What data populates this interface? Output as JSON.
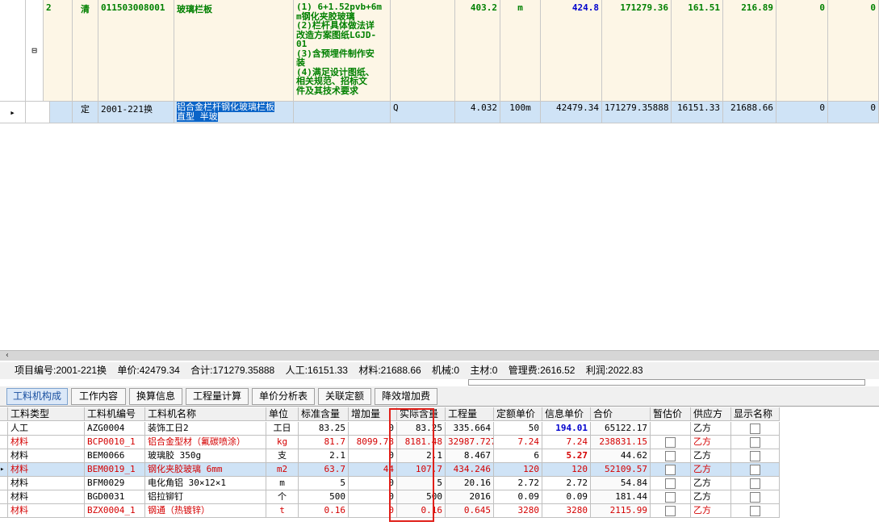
{
  "upper": {
    "row1": {
      "num": "2",
      "type": "清",
      "code": "011503008001",
      "name": "玻璃栏板",
      "feature_lines": [
        "(1) 6+1.52pvb+6m",
        "m钢化夹胶玻璃",
        "(2)栏杆具体做法详",
        "改造方案图纸LGJD-",
        "01",
        "(3)含预埋件制作安",
        "装",
        "(4)满足设计图纸、",
        "相关规范、招标文",
        "件及其技术要求"
      ],
      "qty": "403.2",
      "unit": "m",
      "unit_price": "424.8",
      "total": "171279.36",
      "labor": "161.51",
      "material": "216.89",
      "c1": "0",
      "c2": "0",
      "collapse": "⊟"
    },
    "row2": {
      "type": "定",
      "code": "2001-221换",
      "name_line1": "铝合金栏杆钢化玻璃栏板",
      "name_line2": "直型 半玻",
      "expr": "Q",
      "qty": "4.032",
      "unit": "100m",
      "unit_price": "42479.34",
      "total": "171279.35888",
      "labor": "16151.33",
      "material": "21688.66",
      "c1": "0",
      "c2": "0",
      "marker": "▸"
    }
  },
  "info_bar": {
    "item_code": "项目编号:2001-221换",
    "unit_price": "单价:42479.34",
    "total": "合计:171279.35888",
    "labor": "人工:16151.33",
    "material": "材料:21688.66",
    "machine": "机械:0",
    "main_material": "主材:0",
    "mgmt": "管理费:2616.52",
    "profit": "利润:2022.83"
  },
  "tabs": [
    "工料机构成",
    "工作内容",
    "换算信息",
    "工程量计算",
    "单价分析表",
    "关联定额",
    "降效增加费"
  ],
  "lower": {
    "headers": [
      "工料类型",
      "工料机编号",
      "工料机名称",
      "单位",
      "标准含量",
      "增加量",
      "实际含量",
      "工程量",
      "定额单价",
      "信息单价",
      "合价",
      "暂估价",
      "供应方",
      "显示名称"
    ],
    "rows": [
      {
        "type": "人工",
        "code": "AZG0004",
        "name": "装饰工日2",
        "unit": "工日",
        "std": "83.25",
        "add": "0",
        "actual": "83.25",
        "qty": "335.664",
        "qprice": "50",
        "iprice": "194.01",
        "total": "65122.17",
        "supplier": "乙方",
        "color": "black",
        "iprice_style": "blue",
        "cb": false
      },
      {
        "type": "材料",
        "code": "BCP0010_1",
        "name": "铝合金型材（氟碳喷涂）",
        "unit": "kg",
        "std": "81.7",
        "add": "8099.78",
        "actual": "8181.48",
        "qty": "32987.727",
        "qprice": "7.24",
        "iprice": "7.24",
        "total": "238831.15",
        "supplier": "乙方",
        "color": "red",
        "iprice_style": "",
        "cb": true
      },
      {
        "type": "材料",
        "code": "BEM0066",
        "name": "玻璃胶 350g",
        "unit": "支",
        "std": "2.1",
        "add": "0",
        "actual": "2.1",
        "qty": "8.467",
        "qprice": "6",
        "iprice": "5.27",
        "total": "44.62",
        "supplier": "乙方",
        "color": "black",
        "iprice_style": "boldred",
        "cb": true
      },
      {
        "type": "材料",
        "code": "BEM0019_1",
        "name": "钢化夹胶玻璃 6mm",
        "unit": "m2",
        "std": "63.7",
        "add": "44",
        "actual": "107.7",
        "qty": "434.246",
        "qprice": "120",
        "iprice": "120",
        "total": "52109.57",
        "supplier": "乙方",
        "color": "red",
        "iprice_style": "",
        "cb": true
      },
      {
        "type": "材料",
        "code": "BFM0029",
        "name": "电化角铝 30×12×1",
        "unit": "m",
        "std": "5",
        "add": "0",
        "actual": "5",
        "qty": "20.16",
        "qprice": "2.72",
        "iprice": "2.72",
        "total": "54.84",
        "supplier": "乙方",
        "color": "black",
        "iprice_style": "",
        "cb": true
      },
      {
        "type": "材料",
        "code": "BGD0031",
        "name": "铝拉铆钉",
        "unit": "个",
        "std": "500",
        "add": "0",
        "actual": "500",
        "qty": "2016",
        "qprice": "0.09",
        "iprice": "0.09",
        "total": "181.44",
        "supplier": "乙方",
        "color": "black",
        "iprice_style": "",
        "cb": true
      },
      {
        "type": "材料",
        "code": "BZX0004_1",
        "name": "钢通（热镀锌）",
        "unit": "t",
        "std": "0.16",
        "add": "0",
        "actual": "0.16",
        "qty": "0.645",
        "qprice": "3280",
        "iprice": "3280",
        "total": "2115.99",
        "supplier": "乙方",
        "color": "red",
        "iprice_style": "",
        "cb": true
      }
    ],
    "selected_marker": "▸"
  },
  "scroll_left": "‹"
}
